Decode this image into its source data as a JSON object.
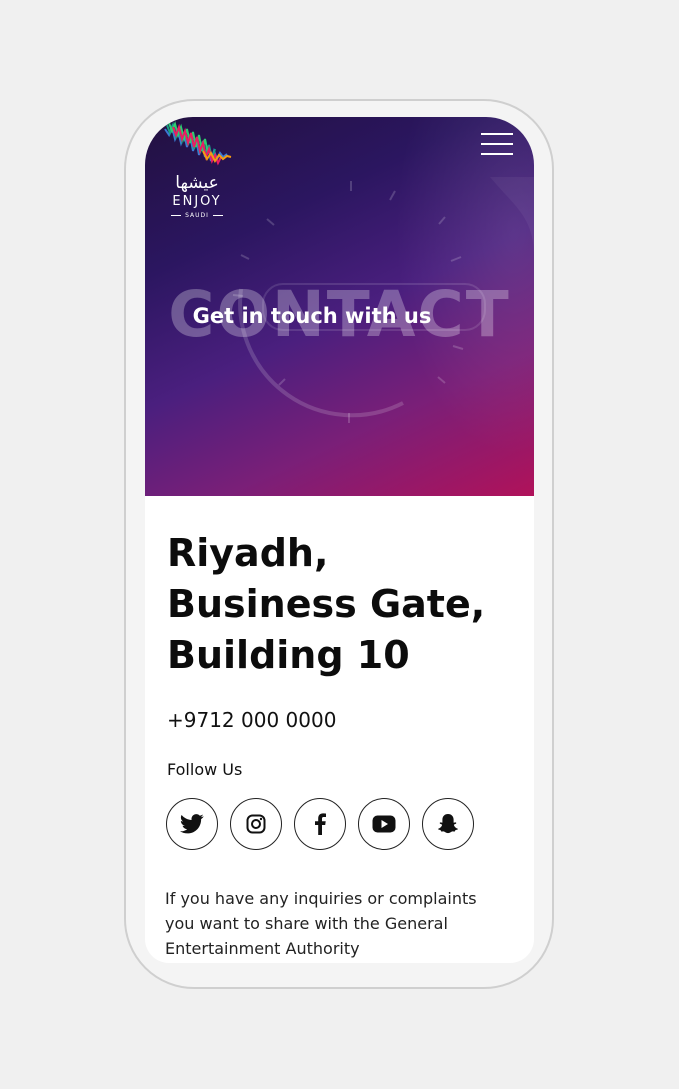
{
  "brand": {
    "logo_arabic": "عيشها",
    "logo_enjoy": "ENJOY",
    "logo_saudi": "SAUDI",
    "wave_colors": [
      "#3a7bd5",
      "#16a085",
      "#2ecc71",
      "#e91e63",
      "#f39c12"
    ]
  },
  "header": {
    "menu_icon": "hamburger-menu-icon"
  },
  "hero": {
    "background_text": "CONTACT",
    "subtitle": "Get in touch with us",
    "gradient_colors": [
      "#221040",
      "#4a1f7e",
      "#b0125a"
    ]
  },
  "contact": {
    "address_lines": [
      "Riyadh,",
      "Business Gate,",
      "Building 10"
    ],
    "phone": "+9712 000 0000",
    "follow_label": "Follow Us",
    "social": [
      {
        "name": "twitter-icon"
      },
      {
        "name": "instagram-icon"
      },
      {
        "name": "facebook-icon"
      },
      {
        "name": "youtube-icon"
      },
      {
        "name": "snapchat-icon"
      }
    ],
    "inquiry_lines": [
      "If you have any inquiries or complaints",
      "you want to share with the General",
      "Entertainment Authority"
    ]
  }
}
